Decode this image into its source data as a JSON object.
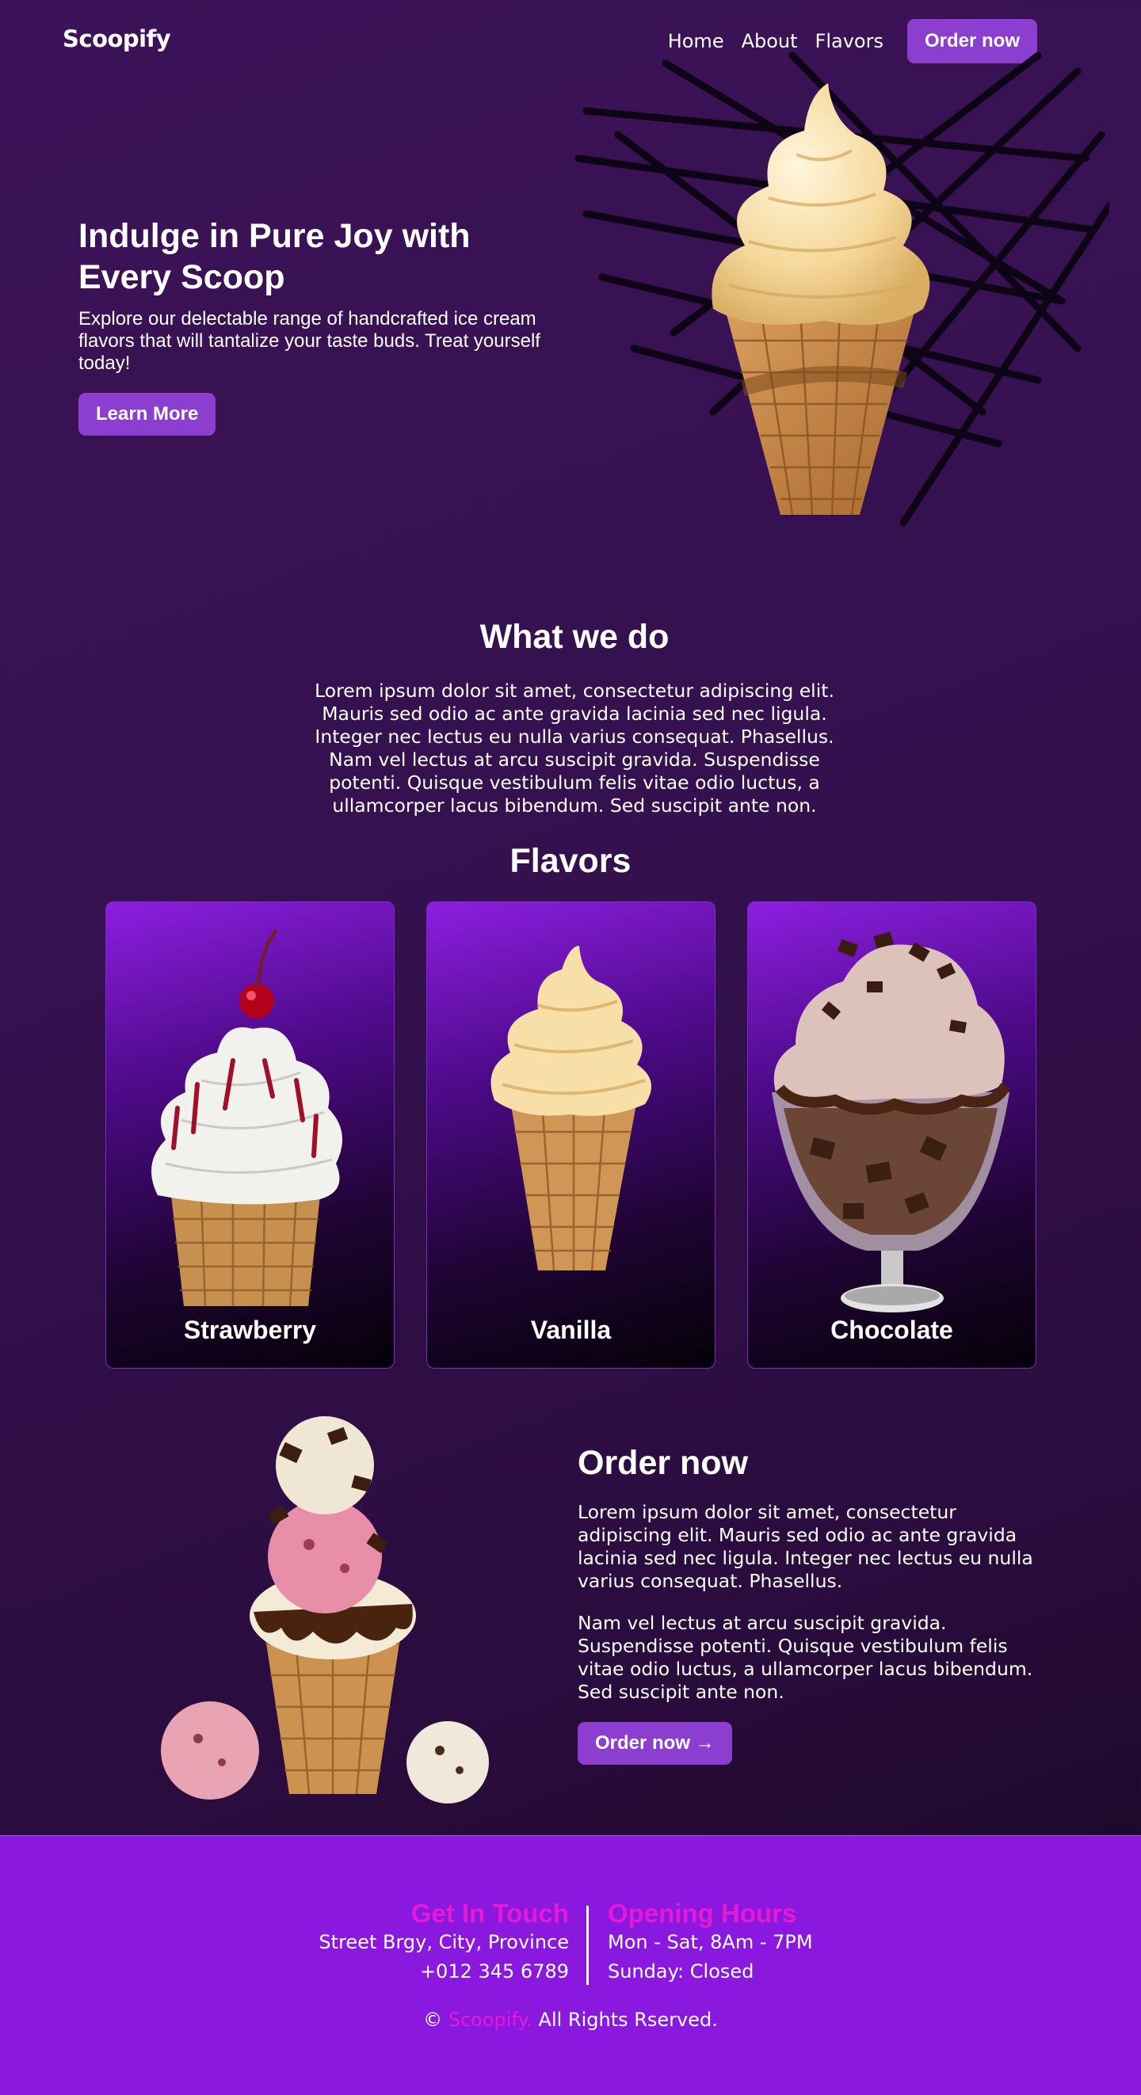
{
  "nav": {
    "logo": "Scoopify",
    "links": [
      "Home",
      "About",
      "Flavors"
    ],
    "cta": "Order now"
  },
  "hero": {
    "title": "Indulge in Pure Joy with Every Scoop",
    "subtitle": "Explore our delectable range of handcrafted ice cream flavors that will tantalize your taste buds. Treat yourself today!",
    "button": "Learn More"
  },
  "what_we_do": {
    "title": "What we do",
    "text": "Lorem ipsum dolor sit amet, consectetur adipiscing elit. Mauris sed odio ac ante gravida lacinia sed nec ligula. Integer nec lectus eu nulla varius consequat. Phasellus. Nam vel lectus at arcu suscipit gravida. Suspendisse potenti. Quisque vestibulum felis vitae odio luctus, a ullamcorper lacus bibendum. Sed suscipit ante non."
  },
  "flavors": {
    "title": "Flavors",
    "items": [
      {
        "label": "Strawberry",
        "icon": "strawberry-sundae-cone-icon"
      },
      {
        "label": "Vanilla",
        "icon": "vanilla-soft-serve-cone-icon"
      },
      {
        "label": "Chocolate",
        "icon": "chocolate-sundae-cup-icon"
      }
    ]
  },
  "order": {
    "title": "Order now",
    "p1": "Lorem ipsum dolor sit amet, consectetur adipiscing elit. Mauris sed odio ac ante gravida lacinia sed nec ligula. Integer nec lectus eu nulla varius consequat. Phasellus.",
    "p2": "Nam vel lectus at arcu suscipit gravida. Suspendisse potenti. Quisque vestibulum felis vitae odio luctus, a ullamcorper lacus bibendum. Sed suscipit ante non.",
    "button": "Order now →"
  },
  "footer": {
    "contact_title": "Get In Touch",
    "address": "Street Brgy, City, Province",
    "phone": "+012 345 6789",
    "hours_title": "Opening Hours",
    "weekday": "Mon - Sat, 8Am - 7PM",
    "sunday": "Sunday: Closed",
    "copyright_symbol": "©",
    "copyright_brand": "Scoopify.",
    "copyright_text": "All Rights Rserved."
  },
  "colors": {
    "background": "#35114f",
    "button": "#8b3ecf",
    "footer": "#8a18de",
    "accent_pink": "#e51ad6"
  }
}
